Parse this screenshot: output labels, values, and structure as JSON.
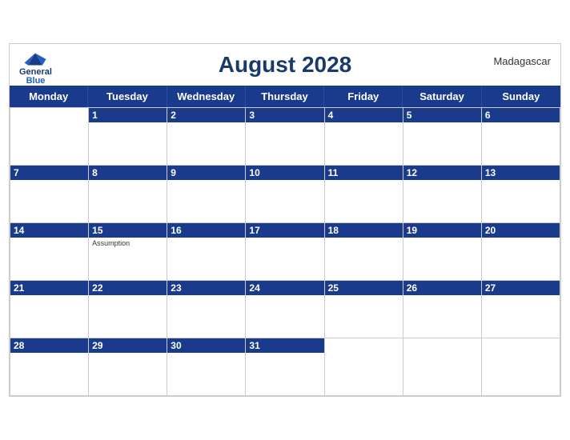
{
  "header": {
    "title": "August 2028",
    "country": "Madagascar",
    "logo": {
      "general": "General",
      "blue": "Blue"
    }
  },
  "dayHeaders": [
    "Monday",
    "Tuesday",
    "Wednesday",
    "Thursday",
    "Friday",
    "Saturday",
    "Sunday"
  ],
  "weeks": [
    [
      {
        "date": null,
        "events": []
      },
      {
        "date": "1",
        "events": []
      },
      {
        "date": "2",
        "events": []
      },
      {
        "date": "3",
        "events": []
      },
      {
        "date": "4",
        "events": []
      },
      {
        "date": "5",
        "events": []
      },
      {
        "date": "6",
        "events": []
      }
    ],
    [
      {
        "date": "7",
        "events": []
      },
      {
        "date": "8",
        "events": []
      },
      {
        "date": "9",
        "events": []
      },
      {
        "date": "10",
        "events": []
      },
      {
        "date": "11",
        "events": []
      },
      {
        "date": "12",
        "events": []
      },
      {
        "date": "13",
        "events": []
      }
    ],
    [
      {
        "date": "14",
        "events": []
      },
      {
        "date": "15",
        "events": [
          "Assumption"
        ]
      },
      {
        "date": "16",
        "events": []
      },
      {
        "date": "17",
        "events": []
      },
      {
        "date": "18",
        "events": []
      },
      {
        "date": "19",
        "events": []
      },
      {
        "date": "20",
        "events": []
      }
    ],
    [
      {
        "date": "21",
        "events": []
      },
      {
        "date": "22",
        "events": []
      },
      {
        "date": "23",
        "events": []
      },
      {
        "date": "24",
        "events": []
      },
      {
        "date": "25",
        "events": []
      },
      {
        "date": "26",
        "events": []
      },
      {
        "date": "27",
        "events": []
      }
    ],
    [
      {
        "date": "28",
        "events": []
      },
      {
        "date": "29",
        "events": []
      },
      {
        "date": "30",
        "events": []
      },
      {
        "date": "31",
        "events": []
      },
      {
        "date": null,
        "events": []
      },
      {
        "date": null,
        "events": []
      },
      {
        "date": null,
        "events": []
      }
    ]
  ],
  "colors": {
    "headerBlue": "#1a3a8c",
    "lightBlue": "#d0d8f0",
    "white": "#ffffff"
  }
}
